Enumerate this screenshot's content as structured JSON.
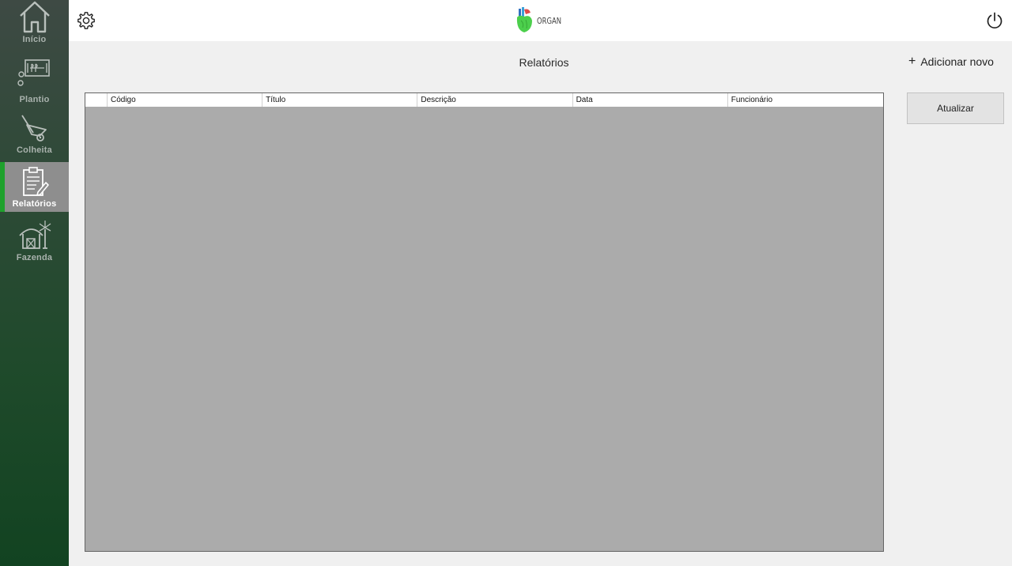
{
  "sidebar": {
    "items": [
      {
        "label": "Início",
        "icon": "home-icon"
      },
      {
        "label": "Plantio",
        "icon": "planting-icon"
      },
      {
        "label": "Colheita",
        "icon": "wheelbarrow-icon"
      },
      {
        "label": "Relatórios",
        "icon": "report-clipboard-icon",
        "active": true
      },
      {
        "label": "Fazenda",
        "icon": "farm-barn-icon"
      }
    ],
    "active_color": "#1ea12c"
  },
  "header": {
    "logo_text": "ORGAN",
    "settings_icon": "gear-icon",
    "power_icon": "power-icon"
  },
  "main": {
    "title": "Relatórios",
    "add_new_label": "Adicionar novo",
    "add_new_icon": "plus-icon",
    "refresh_label": "Atualizar",
    "table": {
      "columns": [
        "Código",
        "Título",
        "Descrição",
        "Data",
        "Funcionário"
      ],
      "rows": []
    }
  }
}
